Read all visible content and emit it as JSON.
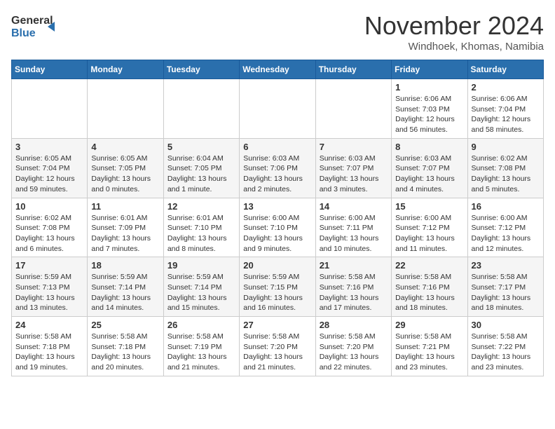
{
  "header": {
    "logo_general": "General",
    "logo_blue": "Blue",
    "month_title": "November 2024",
    "location": "Windhoek, Khomas, Namibia"
  },
  "weekdays": [
    "Sunday",
    "Monday",
    "Tuesday",
    "Wednesday",
    "Thursday",
    "Friday",
    "Saturday"
  ],
  "weeks": [
    [
      {
        "day": "",
        "info": ""
      },
      {
        "day": "",
        "info": ""
      },
      {
        "day": "",
        "info": ""
      },
      {
        "day": "",
        "info": ""
      },
      {
        "day": "",
        "info": ""
      },
      {
        "day": "1",
        "info": "Sunrise: 6:06 AM\nSunset: 7:03 PM\nDaylight: 12 hours\nand 56 minutes."
      },
      {
        "day": "2",
        "info": "Sunrise: 6:06 AM\nSunset: 7:04 PM\nDaylight: 12 hours\nand 58 minutes."
      }
    ],
    [
      {
        "day": "3",
        "info": "Sunrise: 6:05 AM\nSunset: 7:04 PM\nDaylight: 12 hours\nand 59 minutes."
      },
      {
        "day": "4",
        "info": "Sunrise: 6:05 AM\nSunset: 7:05 PM\nDaylight: 13 hours\nand 0 minutes."
      },
      {
        "day": "5",
        "info": "Sunrise: 6:04 AM\nSunset: 7:05 PM\nDaylight: 13 hours\nand 1 minute."
      },
      {
        "day": "6",
        "info": "Sunrise: 6:03 AM\nSunset: 7:06 PM\nDaylight: 13 hours\nand 2 minutes."
      },
      {
        "day": "7",
        "info": "Sunrise: 6:03 AM\nSunset: 7:07 PM\nDaylight: 13 hours\nand 3 minutes."
      },
      {
        "day": "8",
        "info": "Sunrise: 6:03 AM\nSunset: 7:07 PM\nDaylight: 13 hours\nand 4 minutes."
      },
      {
        "day": "9",
        "info": "Sunrise: 6:02 AM\nSunset: 7:08 PM\nDaylight: 13 hours\nand 5 minutes."
      }
    ],
    [
      {
        "day": "10",
        "info": "Sunrise: 6:02 AM\nSunset: 7:08 PM\nDaylight: 13 hours\nand 6 minutes."
      },
      {
        "day": "11",
        "info": "Sunrise: 6:01 AM\nSunset: 7:09 PM\nDaylight: 13 hours\nand 7 minutes."
      },
      {
        "day": "12",
        "info": "Sunrise: 6:01 AM\nSunset: 7:10 PM\nDaylight: 13 hours\nand 8 minutes."
      },
      {
        "day": "13",
        "info": "Sunrise: 6:00 AM\nSunset: 7:10 PM\nDaylight: 13 hours\nand 9 minutes."
      },
      {
        "day": "14",
        "info": "Sunrise: 6:00 AM\nSunset: 7:11 PM\nDaylight: 13 hours\nand 10 minutes."
      },
      {
        "day": "15",
        "info": "Sunrise: 6:00 AM\nSunset: 7:12 PM\nDaylight: 13 hours\nand 11 minutes."
      },
      {
        "day": "16",
        "info": "Sunrise: 6:00 AM\nSunset: 7:12 PM\nDaylight: 13 hours\nand 12 minutes."
      }
    ],
    [
      {
        "day": "17",
        "info": "Sunrise: 5:59 AM\nSunset: 7:13 PM\nDaylight: 13 hours\nand 13 minutes."
      },
      {
        "day": "18",
        "info": "Sunrise: 5:59 AM\nSunset: 7:14 PM\nDaylight: 13 hours\nand 14 minutes."
      },
      {
        "day": "19",
        "info": "Sunrise: 5:59 AM\nSunset: 7:14 PM\nDaylight: 13 hours\nand 15 minutes."
      },
      {
        "day": "20",
        "info": "Sunrise: 5:59 AM\nSunset: 7:15 PM\nDaylight: 13 hours\nand 16 minutes."
      },
      {
        "day": "21",
        "info": "Sunrise: 5:58 AM\nSunset: 7:16 PM\nDaylight: 13 hours\nand 17 minutes."
      },
      {
        "day": "22",
        "info": "Sunrise: 5:58 AM\nSunset: 7:16 PM\nDaylight: 13 hours\nand 18 minutes."
      },
      {
        "day": "23",
        "info": "Sunrise: 5:58 AM\nSunset: 7:17 PM\nDaylight: 13 hours\nand 18 minutes."
      }
    ],
    [
      {
        "day": "24",
        "info": "Sunrise: 5:58 AM\nSunset: 7:18 PM\nDaylight: 13 hours\nand 19 minutes."
      },
      {
        "day": "25",
        "info": "Sunrise: 5:58 AM\nSunset: 7:18 PM\nDaylight: 13 hours\nand 20 minutes."
      },
      {
        "day": "26",
        "info": "Sunrise: 5:58 AM\nSunset: 7:19 PM\nDaylight: 13 hours\nand 21 minutes."
      },
      {
        "day": "27",
        "info": "Sunrise: 5:58 AM\nSunset: 7:20 PM\nDaylight: 13 hours\nand 21 minutes."
      },
      {
        "day": "28",
        "info": "Sunrise: 5:58 AM\nSunset: 7:20 PM\nDaylight: 13 hours\nand 22 minutes."
      },
      {
        "day": "29",
        "info": "Sunrise: 5:58 AM\nSunset: 7:21 PM\nDaylight: 13 hours\nand 23 minutes."
      },
      {
        "day": "30",
        "info": "Sunrise: 5:58 AM\nSunset: 7:22 PM\nDaylight: 13 hours\nand 23 minutes."
      }
    ]
  ]
}
